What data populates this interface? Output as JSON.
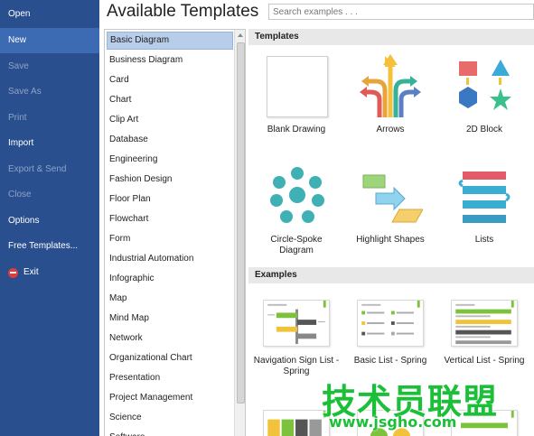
{
  "backstage": {
    "items": [
      {
        "label": "Open",
        "state": "normal"
      },
      {
        "label": "New",
        "state": "active"
      },
      {
        "label": "Save",
        "state": "disabled"
      },
      {
        "label": "Save As",
        "state": "disabled"
      },
      {
        "label": "Print",
        "state": "disabled"
      },
      {
        "label": "Import",
        "state": "normal"
      },
      {
        "label": "Export & Send",
        "state": "disabled"
      },
      {
        "label": "Close",
        "state": "disabled"
      },
      {
        "label": "Options",
        "state": "normal"
      },
      {
        "label": "Free Templates...",
        "state": "normal"
      },
      {
        "label": "Exit",
        "state": "normal",
        "icon": "exit-icon"
      }
    ]
  },
  "header": {
    "title": "Available Templates",
    "search_placeholder": "Search examples . . ."
  },
  "categories": {
    "selected": "Basic Diagram",
    "items": [
      "Basic Diagram",
      "Business Diagram",
      "Card",
      "Chart",
      "Clip Art",
      "Database",
      "Engineering",
      "Fashion Design",
      "Floor Plan",
      "Flowchart",
      "Form",
      "Industrial Automation",
      "Infographic",
      "Map",
      "Mind Map",
      "Network",
      "Organizational Chart",
      "Presentation",
      "Project Management",
      "Science",
      "Software"
    ]
  },
  "templates_section": {
    "title": "Templates",
    "tiles": [
      {
        "label": "Blank Drawing",
        "icon": "blank-page-icon"
      },
      {
        "label": "Arrows",
        "icon": "arrows-icon"
      },
      {
        "label": "2D Block",
        "icon": "2d-block-icon"
      },
      {
        "label": "Circle-Spoke Diagram",
        "icon": "circle-spoke-icon"
      },
      {
        "label": "Highlight Shapes",
        "icon": "highlight-shapes-icon"
      },
      {
        "label": "Lists",
        "icon": "lists-icon"
      }
    ]
  },
  "examples_section": {
    "title": "Examples",
    "tiles": [
      {
        "label": "Navigation Sign List - Spring"
      },
      {
        "label": "Basic List - Spring"
      },
      {
        "label": "Vertical List - Spring"
      }
    ]
  },
  "watermark": {
    "text": "技术员联盟",
    "url": "www.jsgho.com"
  },
  "colors": {
    "backstage_bg": "#2a4f8f",
    "backstage_active": "#3d6bb3",
    "selection": "#b8cdea",
    "watermark": "#1bbf38"
  }
}
